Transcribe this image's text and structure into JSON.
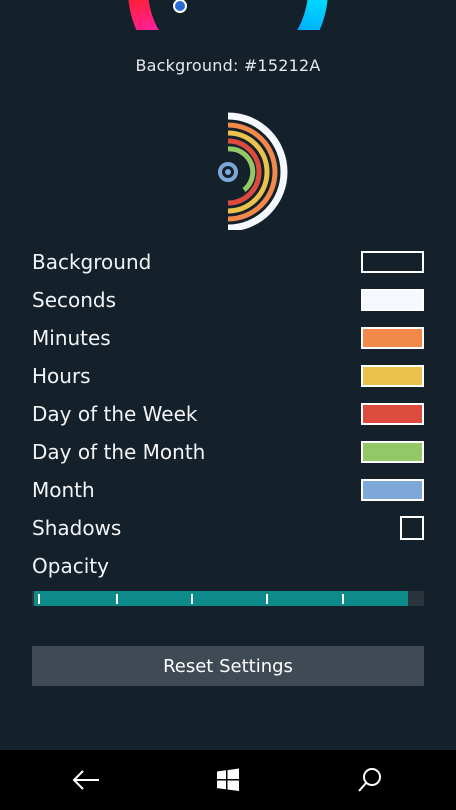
{
  "background_label": "Background: #15212A",
  "colors": {
    "background": "#15212A",
    "seconds": "#F5F8FF",
    "minutes": "#F0894A",
    "hours": "#EBC24D",
    "day_of_week": "#DD4B3E",
    "day_of_month": "#92C866",
    "month": "#7DA8D8"
  },
  "settings": [
    {
      "label": "Background",
      "color": "#15212A"
    },
    {
      "label": "Seconds",
      "color": "#F5F8FF"
    },
    {
      "label": "Minutes",
      "color": "#F0894A"
    },
    {
      "label": "Hours",
      "color": "#EBC24D"
    },
    {
      "label": "Day of the Week",
      "color": "#DD4B3E"
    },
    {
      "label": "Day of the Month",
      "color": "#92C866"
    },
    {
      "label": "Month",
      "color": "#7DA8D8"
    }
  ],
  "shadows": {
    "label": "Shadows",
    "checked": false
  },
  "opacity": {
    "label": "Opacity",
    "value_fraction": 0.97
  },
  "reset_button": "Reset Settings",
  "navbar": {
    "back": "back-arrow-icon",
    "start": "windows-logo-icon",
    "search": "search-icon"
  }
}
